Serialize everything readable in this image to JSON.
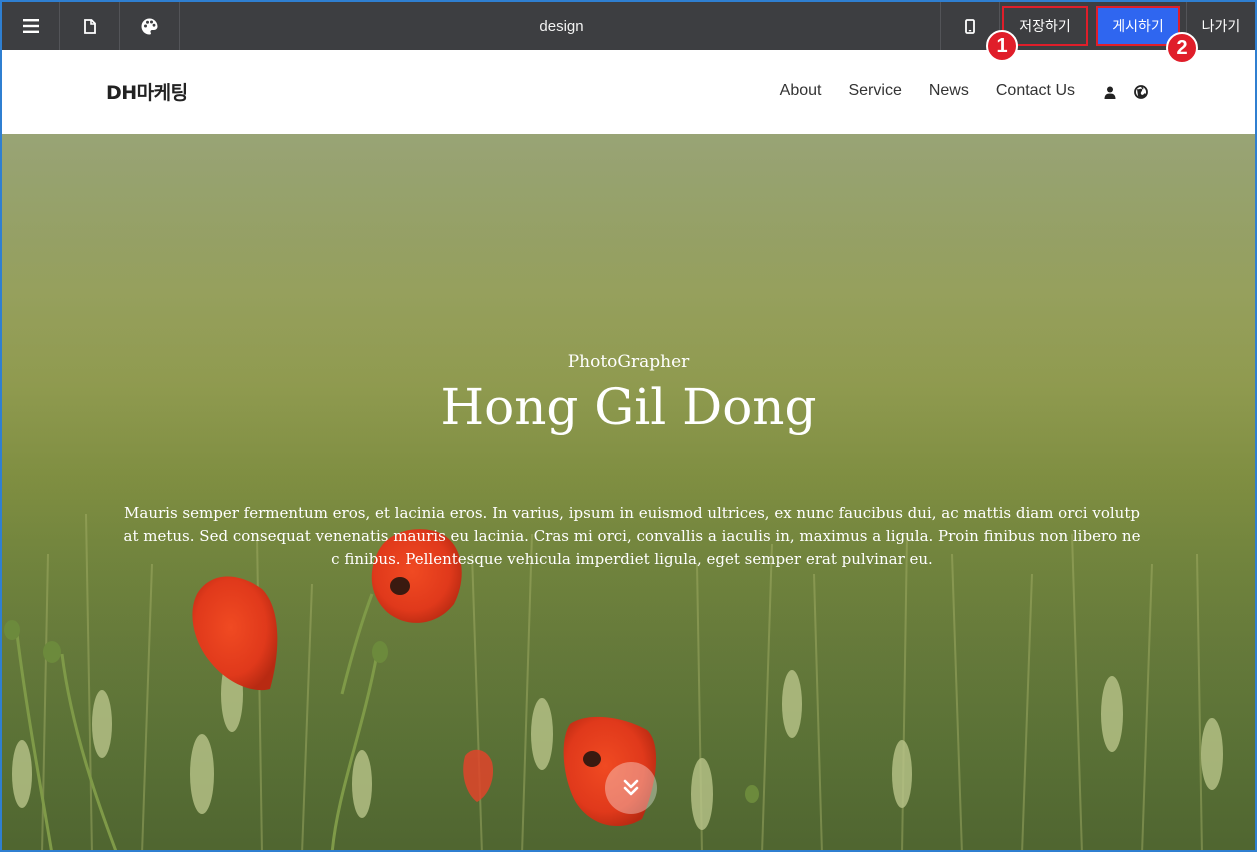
{
  "toolbar": {
    "title": "design",
    "save_label": "저장하기",
    "publish_label": "게시하기",
    "exit_label": "나가기",
    "icons": [
      "menu-icon",
      "page-icon",
      "palette-icon",
      "mobile-icon"
    ]
  },
  "badges": {
    "first": "1",
    "second": "2"
  },
  "site": {
    "logo": "DH마케팅",
    "nav": [
      "About",
      "Service",
      "News",
      "Contact Us"
    ],
    "icons": [
      "user-icon",
      "globe-icon"
    ]
  },
  "hero": {
    "subtitle": "PhotoGrapher",
    "title": "Hong Gil Dong",
    "description": "Mauris semper fermentum eros, et lacinia eros. In varius, ipsum in euismod ultrices, ex nunc faucibus dui, ac mattis diam orci volutpat metus. Sed consequat venenatis mauris eu lacinia. Cras mi orci, convallis a iaculis in, maximus a ligula. Proin finibus non libero nec finibus. Pellentesque vehicula imperdiet ligula, eget semper erat pulvinar eu.",
    "scroll_icon": "double-chevron-down-icon"
  },
  "colors": {
    "toolbar_bg": "#3d3e41",
    "publish_bg": "#2f66f0",
    "highlight": "#e01e2a",
    "frame": "#2f7fd1"
  }
}
